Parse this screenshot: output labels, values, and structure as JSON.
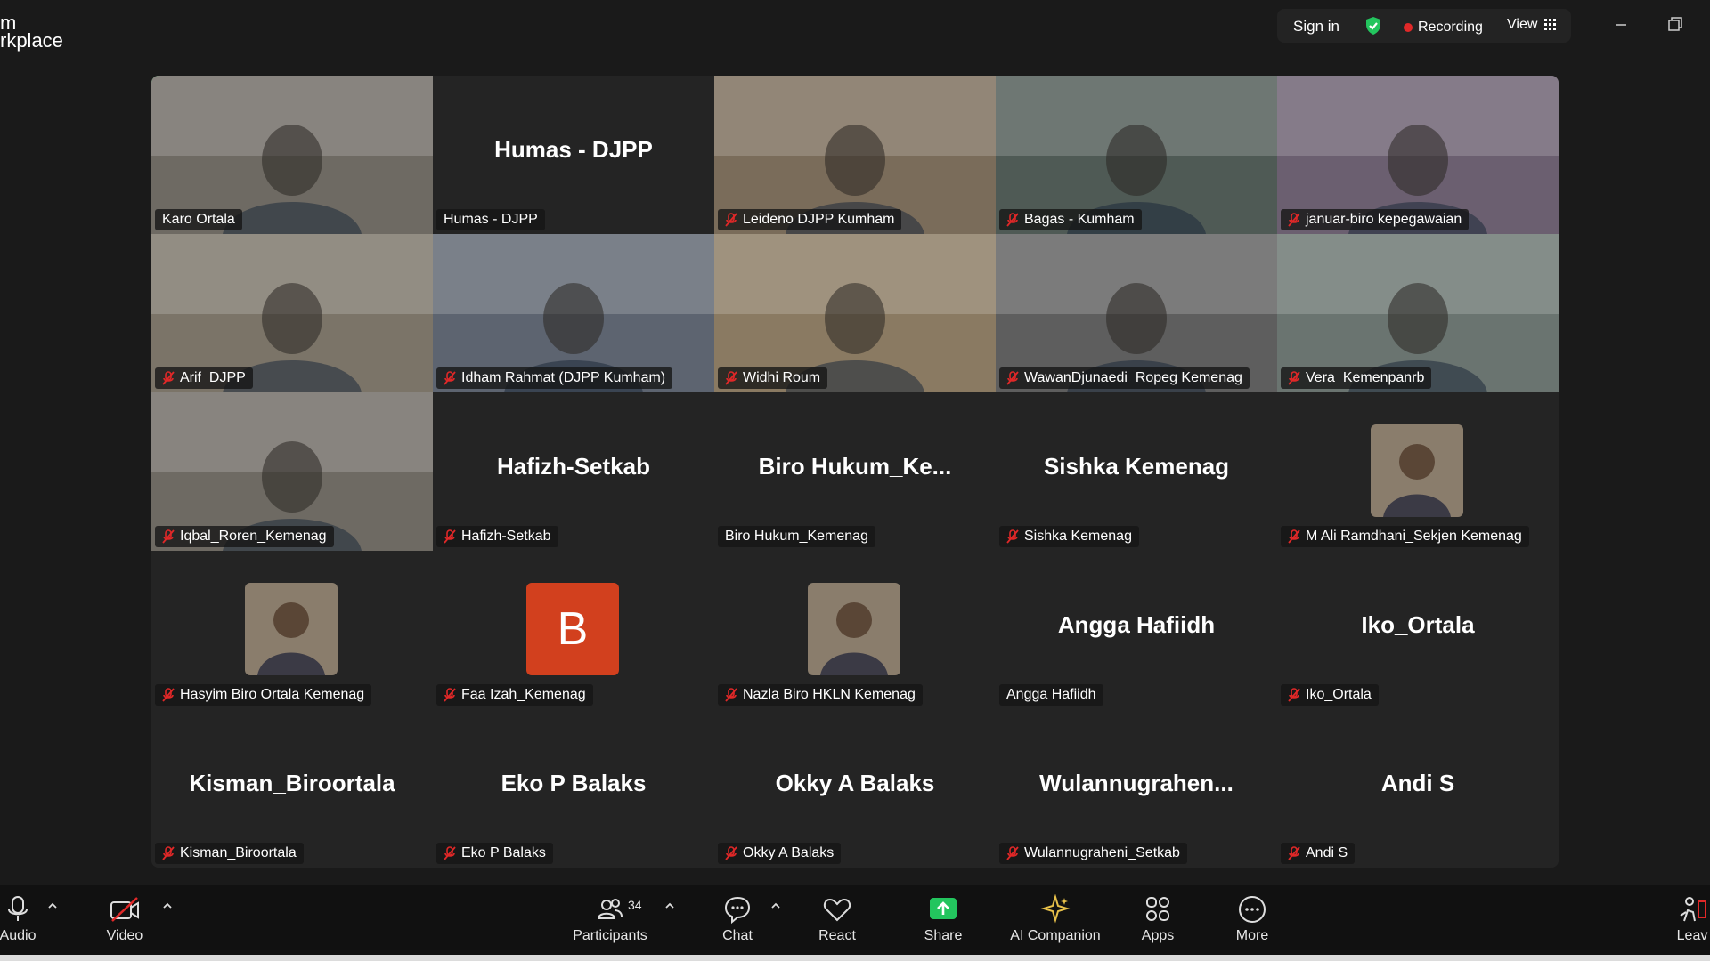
{
  "app": {
    "title": "m\nrkplace"
  },
  "top_controls": {
    "sign_in": "Sign in",
    "recording": "Recording",
    "view": "View"
  },
  "colors": {
    "active_border": "#23d160",
    "recording": "#e02828",
    "share_green": "#23c55e",
    "mic_muted": "#e02828",
    "avatar_b": "#d2401e"
  },
  "tiles": [
    {
      "big": "",
      "label": "Karo Ortala",
      "muted": false,
      "video": true
    },
    {
      "big": "Humas - DJPP",
      "label": "Humas - DJPP",
      "muted": false,
      "video": false
    },
    {
      "big": "",
      "label": "Leideno DJPP Kumham",
      "muted": true,
      "video": true
    },
    {
      "big": "",
      "label": "Bagas - Kumham",
      "muted": true,
      "video": true
    },
    {
      "big": "",
      "label": "januar-biro kepegawaian",
      "muted": true,
      "video": true
    },
    {
      "big": "",
      "label": "Arif_DJPP",
      "muted": true,
      "video": true
    },
    {
      "big": "",
      "label": "Idham Rahmat (DJPP Kumham)",
      "muted": true,
      "video": true
    },
    {
      "big": "",
      "label": "Widhi Roum",
      "muted": true,
      "video": true
    },
    {
      "big": "",
      "label": "WawanDjunaedi_Ropeg Kemenag",
      "muted": true,
      "video": true
    },
    {
      "big": "",
      "label": "Vera_Kemenpanrb",
      "muted": true,
      "video": true
    },
    {
      "big": "",
      "label": "Iqbal_Roren_Kemenag",
      "muted": true,
      "video": true
    },
    {
      "big": "Hafizh-Setkab",
      "label": "Hafizh-Setkab",
      "muted": true,
      "video": false
    },
    {
      "big": "Biro  Hukum_Ke...",
      "label": "Biro Hukum_Kemenag",
      "muted": false,
      "video": false
    },
    {
      "big": "Sishka Kemenag",
      "label": "Sishka Kemenag",
      "muted": true,
      "video": false
    },
    {
      "big": "",
      "label": "M Ali Ramdhani_Sekjen Kemenag",
      "muted": true,
      "video": false,
      "avatar": "photo"
    },
    {
      "big": "",
      "label": "Hasyim Biro Ortala Kemenag",
      "muted": true,
      "video": false,
      "avatar": "photo"
    },
    {
      "big": "",
      "label": "Faa Izah_Kemenag",
      "muted": true,
      "video": false,
      "avatar": "B"
    },
    {
      "big": "",
      "label": "Nazla Biro HKLN Kemenag",
      "muted": true,
      "video": false,
      "avatar": "photo"
    },
    {
      "big": "Angga Hafiidh",
      "label": "Angga Hafiidh",
      "muted": false,
      "video": false
    },
    {
      "big": "Iko_Ortala",
      "label": "Iko_Ortala",
      "muted": true,
      "video": false
    },
    {
      "big": "Kisman_Biroortala",
      "label": "Kisman_Biroortala",
      "muted": true,
      "video": false
    },
    {
      "big": "Eko P Balaks",
      "label": "Eko P Balaks",
      "muted": true,
      "video": false
    },
    {
      "big": "Okky A Balaks",
      "label": "Okky A Balaks",
      "muted": true,
      "video": false
    },
    {
      "big": "Wulannugrahen...",
      "label": "Wulannugraheni_Setkab",
      "muted": true,
      "video": false
    },
    {
      "big": "Andi S",
      "label": "Andi S",
      "muted": true,
      "video": false
    }
  ],
  "toolbar": {
    "audio": "Audio",
    "video": "Video",
    "participants": "Participants",
    "participants_count": "34",
    "chat": "Chat",
    "react": "React",
    "share": "Share",
    "ai_companion": "AI Companion",
    "apps": "Apps",
    "more": "More",
    "leave": "Leav"
  }
}
